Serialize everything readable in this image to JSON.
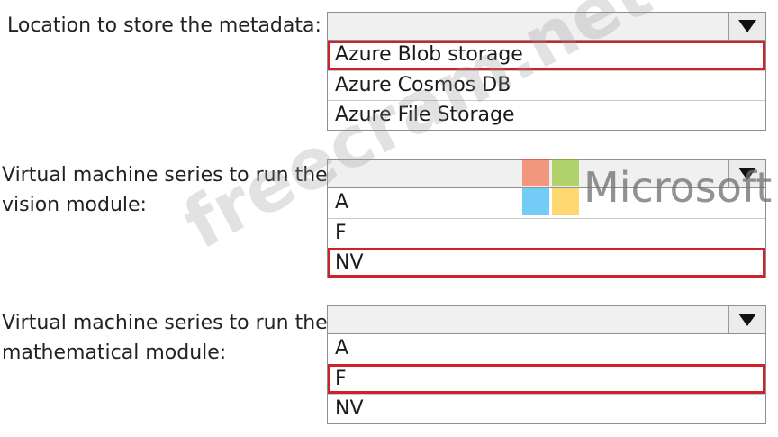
{
  "questions": [
    {
      "label_lines": [
        "Location to store the metadata:"
      ],
      "options": [
        "Azure Blob storage",
        "Azure Cosmos DB",
        "Azure File Storage"
      ],
      "selected_index": 0
    },
    {
      "label_lines": [
        "Virtual machine series to run the",
        "vision module:"
      ],
      "options": [
        "A",
        "F",
        "NV"
      ],
      "selected_index": 2
    },
    {
      "label_lines": [
        "Virtual machine series to run the",
        "mathematical module:"
      ],
      "options": [
        "A",
        "F",
        "NV"
      ],
      "selected_index": 1
    }
  ],
  "watermark": {
    "site": "freecram.net",
    "brand": "Microsoft",
    "logo_colors": [
      "#f25022",
      "#7fba00",
      "#00a4ef",
      "#ffb900"
    ]
  },
  "colors": {
    "selection_outline": "#d0202a"
  },
  "icons": {
    "dropdown_arrow": "triangle-down-icon"
  }
}
